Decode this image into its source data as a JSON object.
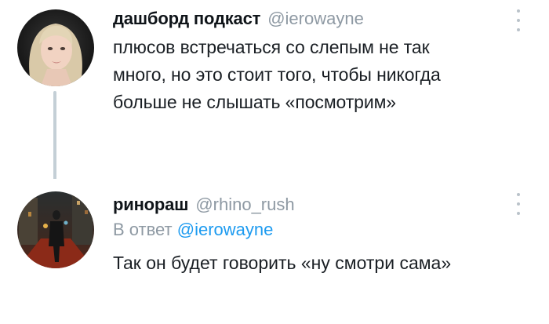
{
  "tweet1": {
    "author_name": "дашборд подкаст",
    "author_handle": "@ierowayne",
    "text_lines": [
      "плюсов встречаться со слепым не так",
      "много, но это стоит того, чтобы никогда",
      "больше не слышать «посмотрим»"
    ],
    "avatar_icon": "user-avatar-blonde-woman",
    "more_icon": "vertical-ellipsis-icon"
  },
  "tweet2": {
    "author_name": "ринораш",
    "author_handle": "@rhino_rush",
    "reply_prefix": "В ответ",
    "reply_to_handle": "@ierowayne",
    "text": "Так он будет говорить «ну смотри сама»",
    "avatar_icon": "user-avatar-night-street",
    "more_icon": "vertical-ellipsis-icon"
  },
  "colors": {
    "text": "#0f1419",
    "muted": "#8e99a3",
    "link": "#1d9bf0",
    "thread_line": "#c4cfd6",
    "background": "#ffffff"
  }
}
